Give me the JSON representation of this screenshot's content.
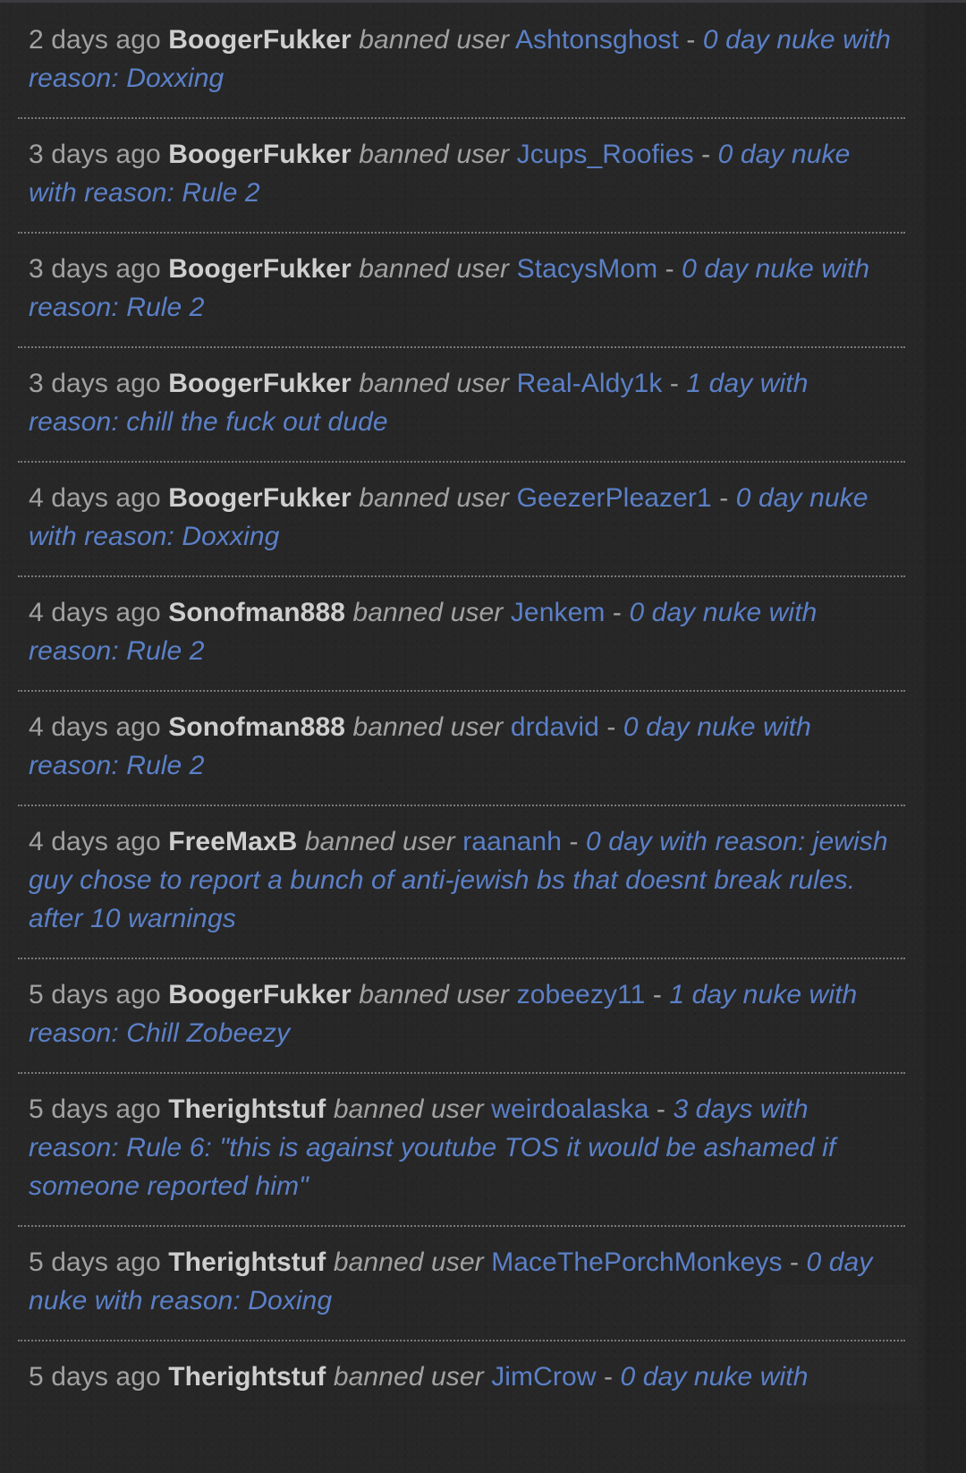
{
  "theme": {
    "background": "#272727",
    "divider": "#7b7b7b",
    "time_color": "#a2a2a2",
    "moderator_color": "#cfcfcf",
    "action_color": "#a2a2a2",
    "link_color": "#5b80c8",
    "details_color": "#5b80c8"
  },
  "moderation_log": {
    "entries": [
      {
        "time": "2 days ago",
        "moderator": "BoogerFukker",
        "action": "banned user",
        "target": "Ashtonsghost",
        "separator": "-",
        "details": "0 day nuke with reason: Doxxing"
      },
      {
        "time": "3 days ago",
        "moderator": "BoogerFukker",
        "action": "banned user",
        "target": "Jcups_Roofies",
        "separator": "-",
        "details": "0 day nuke with reason: Rule 2"
      },
      {
        "time": "3 days ago",
        "moderator": "BoogerFukker",
        "action": "banned user",
        "target": "StacysMom",
        "separator": "-",
        "details": "0 day nuke with reason: Rule 2"
      },
      {
        "time": "3 days ago",
        "moderator": "BoogerFukker",
        "action": "banned user",
        "target": "Real-Aldy1k",
        "separator": "-",
        "details": "1 day with reason: chill the fuck out dude"
      },
      {
        "time": "4 days ago",
        "moderator": "BoogerFukker",
        "action": "banned user",
        "target": "GeezerPleazer1",
        "separator": "-",
        "details": "0 day nuke with reason: Doxxing"
      },
      {
        "time": "4 days ago",
        "moderator": "Sonofman888",
        "action": "banned user",
        "target": "Jenkem",
        "separator": "-",
        "details": "0 day nuke with reason: Rule 2"
      },
      {
        "time": "4 days ago",
        "moderator": "Sonofman888",
        "action": "banned user",
        "target": "drdavid",
        "separator": "-",
        "details": "0 day nuke with reason: Rule 2"
      },
      {
        "time": "4 days ago",
        "moderator": "FreeMaxB",
        "action": "banned user",
        "target": "raananh",
        "separator": "-",
        "details": "0 day with reason: jewish guy chose to report a bunch of anti-jewish bs that doesnt break rules. after 10 warnings"
      },
      {
        "time": "5 days ago",
        "moderator": "BoogerFukker",
        "action": "banned user",
        "target": "zobeezy11",
        "separator": "-",
        "details": "1 day nuke with reason: Chill Zobeezy"
      },
      {
        "time": "5 days ago",
        "moderator": "Therightstuf",
        "action": "banned user",
        "target": "weirdoalaska",
        "separator": "-",
        "details": "3 days with reason: Rule 6: \"this is against youtube TOS it would be ashamed if someone reported him\""
      },
      {
        "time": "5 days ago",
        "moderator": "Therightstuf",
        "action": "banned user",
        "target": "MaceThePorchMonkeys",
        "separator": "-",
        "details": "0 day nuke with reason: Doxing"
      },
      {
        "time": "5 days ago",
        "moderator": "Therightstuf",
        "action": "banned user",
        "target": "JimCrow",
        "separator": "-",
        "details": "0 day nuke with"
      }
    ]
  }
}
